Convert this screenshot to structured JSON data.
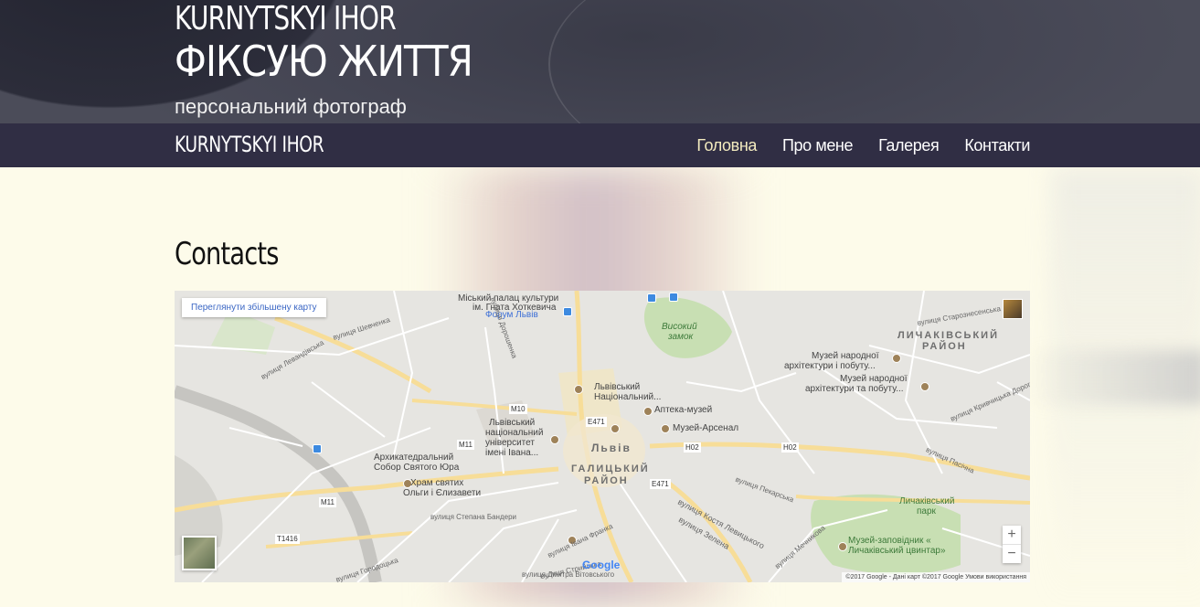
{
  "header": {
    "site_name": "KURNYTSKYI IHOR",
    "slogan": "ФІКСУЮ ЖИТТЯ",
    "tagline": "персональний фотограф"
  },
  "navbar": {
    "brand": "KURNYTSKYI IHOR",
    "items": [
      {
        "label": "Головна",
        "active": true
      },
      {
        "label": "Про мене",
        "active": false
      },
      {
        "label": "Галерея",
        "active": false
      },
      {
        "label": "Контакти",
        "active": false
      }
    ],
    "active_color": "#f3ebbf",
    "bg_color": "#302e44"
  },
  "main": {
    "title": "Contacts"
  },
  "map": {
    "enlarge_label": "Переглянути збільшену карту",
    "zoom_in": "+",
    "zoom_out": "−",
    "google_label": "Google",
    "attribution": "©2017 Google - Дані карт ©2017 Google    Умови використання",
    "labels": {
      "palace": "Міський палац культури",
      "palace2": "ім. Гната Хоткевича",
      "forum": "Форум Львів",
      "high_castle": "Високий",
      "high_castle2": "замок",
      "lychakiv_district": "ЛИЧАКІВСЬКИЙ",
      "lychakiv_district2": "РАЙОН",
      "museum_folk": "Музей народної",
      "museum_folk2": "архітектури і побуту...",
      "museum_folk3": "Музей народної",
      "museum_folk4": "архітектури та побуту...",
      "univ_national": "Львівський",
      "univ_national2": "Національний...",
      "pharmacy": "Аптека-музей",
      "arsenal": "Музей-Арсенал",
      "univ": "Львівський",
      "univ2": "національний",
      "univ3": "університет",
      "univ4": "імені Івана...",
      "lviv": "Львів",
      "halytskyi": "ГАЛИЦЬКИЙ",
      "halytskyi2": "РАЙОН",
      "cathedral": "Архикатедральний",
      "cathedral2": "Собор Святого Юра",
      "temple": "Храм святих",
      "temple2": "Ольги і Єлизавети",
      "lychakiv_park": "Личаківський",
      "lychakiv_park2": "парк",
      "cemetery": "Музей-заповідник «",
      "cemetery2": "Личаківський цвинтар»",
      "shevchenka": "вулиця Шевченка",
      "levytskoho": "вулиця Костя Левицького",
      "zelena": "вулиця Зелена",
      "bandery": "вулиця Степана Бандери",
      "pekarska": "вулиця Пекарська",
      "m10": "M10",
      "m11": "M11",
      "m11b": "M11",
      "e471": "E471",
      "e471b": "E471",
      "h02": "H02",
      "h02b": "H02",
      "t1416": "T1416",
      "starozna": "вулиця Старознесенська",
      "krivch": "вулиця Кривчицька Дорога",
      "levandivska": "вулиця Левандівська",
      "horodotska": "вулиця Городоцька",
      "pasichna": "вулиця Пасічна",
      "stryiska": "вулиця Стрийська",
      "mechnykova": "вулиця Мечникова",
      "ivana": "вулиця Івана Франка",
      "dmytra": "вулиця Дмитра Вітовського",
      "doroshenka": "вулиця Дорошенка"
    }
  }
}
